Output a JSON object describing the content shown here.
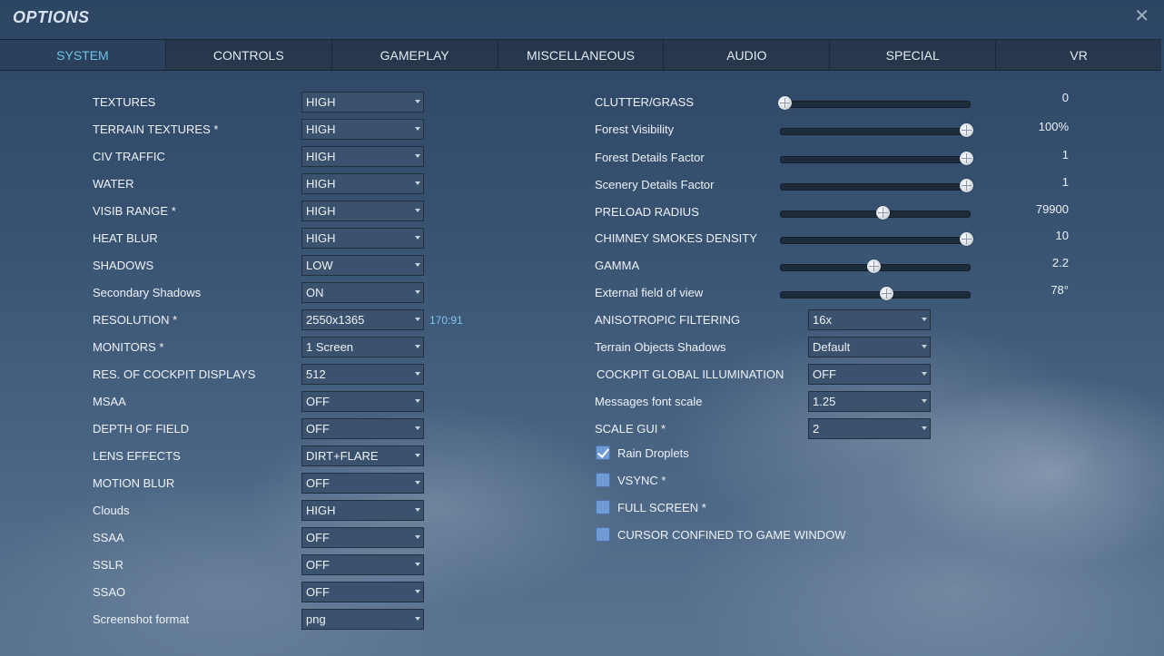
{
  "window": {
    "title": "OPTIONS",
    "close_glyph": "✕"
  },
  "tabs": [
    {
      "label": "SYSTEM",
      "active": true
    },
    {
      "label": "CONTROLS",
      "active": false
    },
    {
      "label": "GAMEPLAY",
      "active": false
    },
    {
      "label": "MISCELLANEOUS",
      "active": false
    },
    {
      "label": "AUDIO",
      "active": false
    },
    {
      "label": "SPECIAL",
      "active": false
    },
    {
      "label": "VR",
      "active": false
    }
  ],
  "left_settings": [
    {
      "label": "TEXTURES",
      "value": "HIGH"
    },
    {
      "label": "TERRAIN TEXTURES *",
      "value": "HIGH"
    },
    {
      "label": "CIV TRAFFIC",
      "value": "HIGH"
    },
    {
      "label": "WATER",
      "value": "HIGH"
    },
    {
      "label": "VISIB RANGE *",
      "value": "HIGH"
    },
    {
      "label": "HEAT BLUR",
      "value": "HIGH"
    },
    {
      "label": "SHADOWS",
      "value": "LOW"
    },
    {
      "label": "Secondary Shadows",
      "value": "ON"
    },
    {
      "label": "RESOLUTION *",
      "value": "2550x1365"
    },
    {
      "label": "MONITORS *",
      "value": "1 Screen"
    },
    {
      "label": "RES. OF COCKPIT DISPLAYS",
      "value": "512"
    },
    {
      "label": "MSAA",
      "value": "OFF"
    },
    {
      "label": "DEPTH OF FIELD",
      "value": "OFF"
    },
    {
      "label": "LENS EFFECTS",
      "value": "DIRT+FLARE"
    },
    {
      "label": "MOTION BLUR",
      "value": "OFF"
    },
    {
      "label": "Clouds",
      "value": "HIGH"
    },
    {
      "label": "SSAA",
      "value": "OFF"
    },
    {
      "label": "SSLR",
      "value": "OFF"
    },
    {
      "label": "SSAO",
      "value": "OFF"
    },
    {
      "label": "Screenshot format",
      "value": "png"
    }
  ],
  "resolution_aspect": "170:91",
  "sliders": [
    {
      "label": "CLUTTER/GRASS",
      "value_text": "0",
      "fraction": 0.0
    },
    {
      "label": "Forest Visibility",
      "value_text": "100%",
      "fraction": 1.0
    },
    {
      "label": "Forest Details Factor",
      "value_text": "1",
      "fraction": 1.0
    },
    {
      "label": "Scenery Details Factor",
      "value_text": "1",
      "fraction": 1.0
    },
    {
      "label": "PRELOAD RADIUS",
      "value_text": "79900",
      "fraction": 0.54
    },
    {
      "label": "CHIMNEY SMOKES DENSITY",
      "value_text": "10",
      "fraction": 1.0
    },
    {
      "label": "GAMMA",
      "value_text": "2.2",
      "fraction": 0.49
    },
    {
      "label": "External field of view",
      "value_text": "78°",
      "fraction": 0.56
    }
  ],
  "right_dropdowns": [
    {
      "label": "ANISOTROPIC FILTERING",
      "value": "16x"
    },
    {
      "label": "Terrain Objects Shadows",
      "value": "Default"
    },
    {
      "label": "COCKPIT GLOBAL ILLUMINATION",
      "value": "OFF"
    },
    {
      "label": "Messages font scale",
      "value": "1.25"
    },
    {
      "label": "SCALE GUI *",
      "value": "2"
    }
  ],
  "checkboxes": [
    {
      "label": "Rain Droplets",
      "checked": true
    },
    {
      "label": "VSYNC *",
      "checked": false
    },
    {
      "label": "FULL SCREEN *",
      "checked": false
    },
    {
      "label": "CURSOR CONFINED TO GAME WINDOW",
      "checked": false
    }
  ]
}
